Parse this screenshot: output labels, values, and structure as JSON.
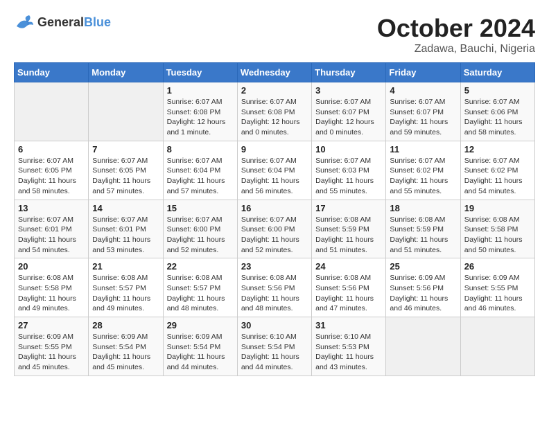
{
  "header": {
    "logo_general": "General",
    "logo_blue": "Blue",
    "title": "October 2024",
    "location": "Zadawa, Bauchi, Nigeria"
  },
  "weekdays": [
    "Sunday",
    "Monday",
    "Tuesday",
    "Wednesday",
    "Thursday",
    "Friday",
    "Saturday"
  ],
  "weeks": [
    [
      {
        "day": "",
        "sunrise": "",
        "sunset": "",
        "daylight": ""
      },
      {
        "day": "",
        "sunrise": "",
        "sunset": "",
        "daylight": ""
      },
      {
        "day": "1",
        "sunrise": "Sunrise: 6:07 AM",
        "sunset": "Sunset: 6:08 PM",
        "daylight": "Daylight: 12 hours and 1 minute."
      },
      {
        "day": "2",
        "sunrise": "Sunrise: 6:07 AM",
        "sunset": "Sunset: 6:08 PM",
        "daylight": "Daylight: 12 hours and 0 minutes."
      },
      {
        "day": "3",
        "sunrise": "Sunrise: 6:07 AM",
        "sunset": "Sunset: 6:07 PM",
        "daylight": "Daylight: 12 hours and 0 minutes."
      },
      {
        "day": "4",
        "sunrise": "Sunrise: 6:07 AM",
        "sunset": "Sunset: 6:07 PM",
        "daylight": "Daylight: 11 hours and 59 minutes."
      },
      {
        "day": "5",
        "sunrise": "Sunrise: 6:07 AM",
        "sunset": "Sunset: 6:06 PM",
        "daylight": "Daylight: 11 hours and 58 minutes."
      }
    ],
    [
      {
        "day": "6",
        "sunrise": "Sunrise: 6:07 AM",
        "sunset": "Sunset: 6:05 PM",
        "daylight": "Daylight: 11 hours and 58 minutes."
      },
      {
        "day": "7",
        "sunrise": "Sunrise: 6:07 AM",
        "sunset": "Sunset: 6:05 PM",
        "daylight": "Daylight: 11 hours and 57 minutes."
      },
      {
        "day": "8",
        "sunrise": "Sunrise: 6:07 AM",
        "sunset": "Sunset: 6:04 PM",
        "daylight": "Daylight: 11 hours and 57 minutes."
      },
      {
        "day": "9",
        "sunrise": "Sunrise: 6:07 AM",
        "sunset": "Sunset: 6:04 PM",
        "daylight": "Daylight: 11 hours and 56 minutes."
      },
      {
        "day": "10",
        "sunrise": "Sunrise: 6:07 AM",
        "sunset": "Sunset: 6:03 PM",
        "daylight": "Daylight: 11 hours and 55 minutes."
      },
      {
        "day": "11",
        "sunrise": "Sunrise: 6:07 AM",
        "sunset": "Sunset: 6:02 PM",
        "daylight": "Daylight: 11 hours and 55 minutes."
      },
      {
        "day": "12",
        "sunrise": "Sunrise: 6:07 AM",
        "sunset": "Sunset: 6:02 PM",
        "daylight": "Daylight: 11 hours and 54 minutes."
      }
    ],
    [
      {
        "day": "13",
        "sunrise": "Sunrise: 6:07 AM",
        "sunset": "Sunset: 6:01 PM",
        "daylight": "Daylight: 11 hours and 54 minutes."
      },
      {
        "day": "14",
        "sunrise": "Sunrise: 6:07 AM",
        "sunset": "Sunset: 6:01 PM",
        "daylight": "Daylight: 11 hours and 53 minutes."
      },
      {
        "day": "15",
        "sunrise": "Sunrise: 6:07 AM",
        "sunset": "Sunset: 6:00 PM",
        "daylight": "Daylight: 11 hours and 52 minutes."
      },
      {
        "day": "16",
        "sunrise": "Sunrise: 6:07 AM",
        "sunset": "Sunset: 6:00 PM",
        "daylight": "Daylight: 11 hours and 52 minutes."
      },
      {
        "day": "17",
        "sunrise": "Sunrise: 6:08 AM",
        "sunset": "Sunset: 5:59 PM",
        "daylight": "Daylight: 11 hours and 51 minutes."
      },
      {
        "day": "18",
        "sunrise": "Sunrise: 6:08 AM",
        "sunset": "Sunset: 5:59 PM",
        "daylight": "Daylight: 11 hours and 51 minutes."
      },
      {
        "day": "19",
        "sunrise": "Sunrise: 6:08 AM",
        "sunset": "Sunset: 5:58 PM",
        "daylight": "Daylight: 11 hours and 50 minutes."
      }
    ],
    [
      {
        "day": "20",
        "sunrise": "Sunrise: 6:08 AM",
        "sunset": "Sunset: 5:58 PM",
        "daylight": "Daylight: 11 hours and 49 minutes."
      },
      {
        "day": "21",
        "sunrise": "Sunrise: 6:08 AM",
        "sunset": "Sunset: 5:57 PM",
        "daylight": "Daylight: 11 hours and 49 minutes."
      },
      {
        "day": "22",
        "sunrise": "Sunrise: 6:08 AM",
        "sunset": "Sunset: 5:57 PM",
        "daylight": "Daylight: 11 hours and 48 minutes."
      },
      {
        "day": "23",
        "sunrise": "Sunrise: 6:08 AM",
        "sunset": "Sunset: 5:56 PM",
        "daylight": "Daylight: 11 hours and 48 minutes."
      },
      {
        "day": "24",
        "sunrise": "Sunrise: 6:08 AM",
        "sunset": "Sunset: 5:56 PM",
        "daylight": "Daylight: 11 hours and 47 minutes."
      },
      {
        "day": "25",
        "sunrise": "Sunrise: 6:09 AM",
        "sunset": "Sunset: 5:56 PM",
        "daylight": "Daylight: 11 hours and 46 minutes."
      },
      {
        "day": "26",
        "sunrise": "Sunrise: 6:09 AM",
        "sunset": "Sunset: 5:55 PM",
        "daylight": "Daylight: 11 hours and 46 minutes."
      }
    ],
    [
      {
        "day": "27",
        "sunrise": "Sunrise: 6:09 AM",
        "sunset": "Sunset: 5:55 PM",
        "daylight": "Daylight: 11 hours and 45 minutes."
      },
      {
        "day": "28",
        "sunrise": "Sunrise: 6:09 AM",
        "sunset": "Sunset: 5:54 PM",
        "daylight": "Daylight: 11 hours and 45 minutes."
      },
      {
        "day": "29",
        "sunrise": "Sunrise: 6:09 AM",
        "sunset": "Sunset: 5:54 PM",
        "daylight": "Daylight: 11 hours and 44 minutes."
      },
      {
        "day": "30",
        "sunrise": "Sunrise: 6:10 AM",
        "sunset": "Sunset: 5:54 PM",
        "daylight": "Daylight: 11 hours and 44 minutes."
      },
      {
        "day": "31",
        "sunrise": "Sunrise: 6:10 AM",
        "sunset": "Sunset: 5:53 PM",
        "daylight": "Daylight: 11 hours and 43 minutes."
      },
      {
        "day": "",
        "sunrise": "",
        "sunset": "",
        "daylight": ""
      },
      {
        "day": "",
        "sunrise": "",
        "sunset": "",
        "daylight": ""
      }
    ]
  ]
}
